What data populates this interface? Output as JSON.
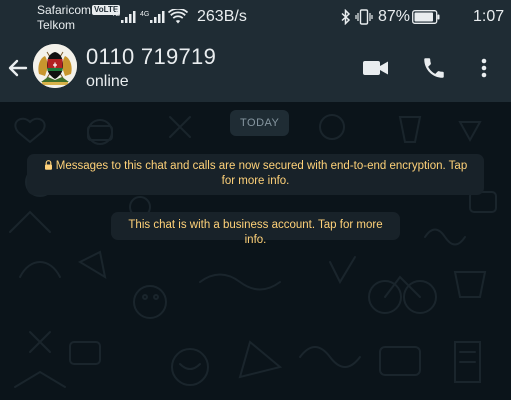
{
  "status_bar": {
    "carrier_1": "Safaricom",
    "volte_badge": "VoLTE",
    "carrier_2": "Telkom",
    "network_1": "4G",
    "network_2": "4G",
    "net_speed": "263B/s",
    "battery": "87%",
    "time": "1:07"
  },
  "header": {
    "contact_name": "0110 719719",
    "contact_status": "online"
  },
  "chat": {
    "date_label": "TODAY",
    "encryption_notice": "Messages to this chat and calls are now secured with end-to-end encryption. Tap for more info.",
    "business_notice": "This chat is with a business account. Tap for more info."
  },
  "colors": {
    "app_bar": "#1f2c34",
    "chat_background": "#0b141a",
    "system_message_bg": "#182229",
    "system_message_text": "#ffd279"
  },
  "icons": {
    "back": "arrow-left-icon",
    "video": "video-camera-icon",
    "call": "phone-icon",
    "menu": "more-vertical-icon",
    "lock": "lock-icon"
  }
}
